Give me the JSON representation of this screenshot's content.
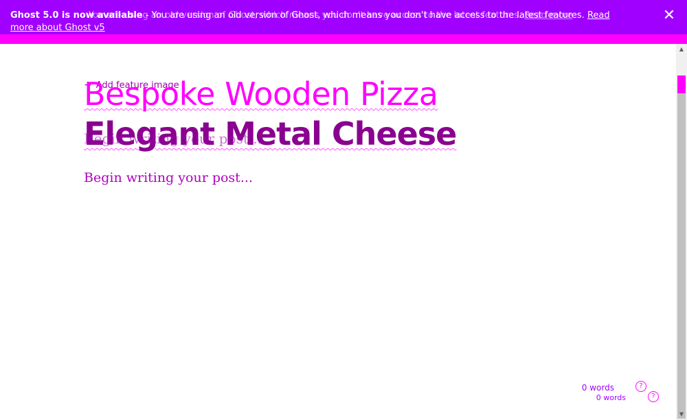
{
  "banner": {
    "bold_text": "Ghost 5.0 is now available",
    "message": " - You are using an old version of Ghost, which means you don't have access to the latest features.",
    "link": "Read more about Ghost v5",
    "overlay_message": "- You are using an old version of Ghost, which means you don't have access to the latest features.",
    "overlay_link": "Read more",
    "close_glyph": "✕",
    "background": "#a000ff",
    "accent": "#ff00ff"
  },
  "editor": {
    "add_feature_image": "Add feature image",
    "plus_glyph": "+",
    "title_ghost": "Bespoke Wooden Pizza",
    "title": "Elegant Metal Cheese",
    "body_ghost": "Begin writing your post...",
    "body_placeholder": "Begin writing your post..."
  },
  "status": {
    "word_count": "0 words",
    "word_count_secondary": "0 words",
    "help_glyph": "?"
  },
  "scrollbar": {
    "up_glyph": "▲",
    "down_glyph": "▼"
  }
}
